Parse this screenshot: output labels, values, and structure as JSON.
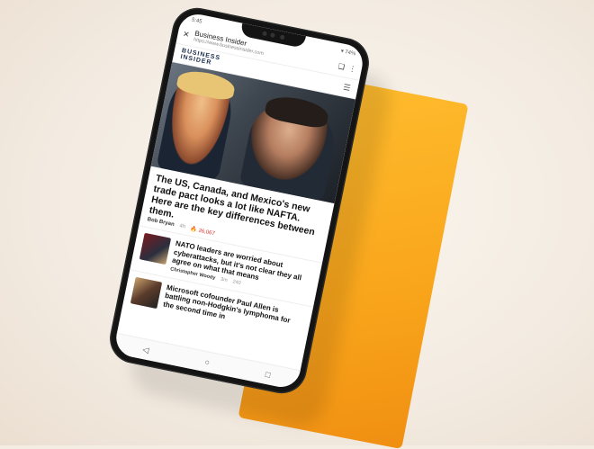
{
  "status_bar": {
    "time": "5:45",
    "right": "▾ 74%"
  },
  "browser": {
    "close_icon": "×",
    "title": "Business Insider",
    "url": "https://www.businessinsider.com",
    "bookmark_icon": "❑",
    "menu_icon": "⋮"
  },
  "site": {
    "logo_line1": "BUSINESS",
    "logo_line2": "INSIDER",
    "menu_icon": "☰"
  },
  "lead": {
    "headline": "The US, Canada, and Mexico's new trade pact looks a lot like NAFTA. Here are the key differences between them.",
    "author": "Bob Bryan",
    "time": "4h",
    "views": "🔥 26,067"
  },
  "stories": [
    {
      "title": "NATO leaders are worried about cyberattacks, but it's not clear they all agree on what that means",
      "author": "Christopher Woody",
      "time": "3m",
      "count": "240"
    },
    {
      "title": "Microsoft cofounder Paul Allen is battling non-Hodgkin's lymphoma for the second time in",
      "author": "",
      "time": "",
      "count": ""
    }
  ],
  "nav": {
    "back": "◁",
    "home": "○",
    "recent": "□"
  },
  "colors": {
    "orange": "#f9a51b",
    "accent_red": "#e0312f"
  }
}
